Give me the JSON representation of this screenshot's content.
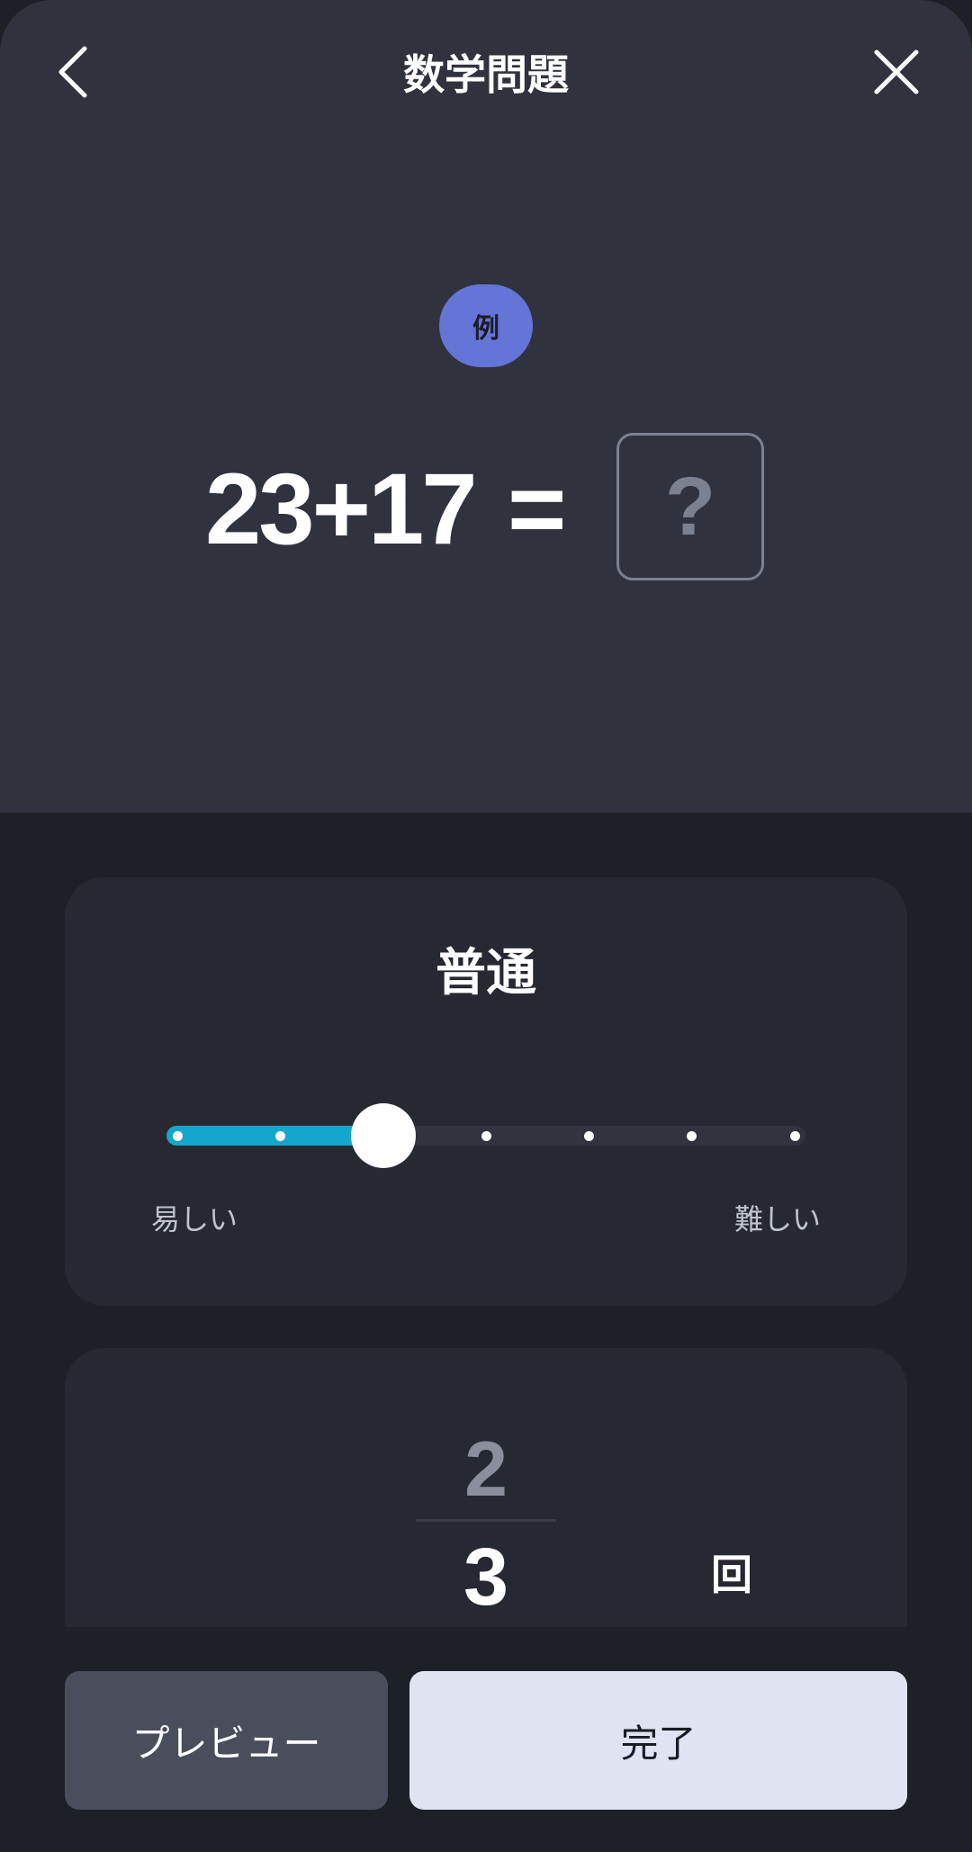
{
  "header": {
    "title": "数学問題",
    "back_icon": "chevron-left-icon",
    "close_icon": "close-icon"
  },
  "example": {
    "badge": "例",
    "badge_color": "#6474d7",
    "equation": "23+17",
    "equals": "=",
    "answer_placeholder": "?"
  },
  "difficulty": {
    "label": "普通",
    "min_label": "易しい",
    "max_label": "難しい",
    "levels": 7,
    "selected_index": 2,
    "accent_color": "#16a6cb"
  },
  "count_picker": {
    "previous": "2",
    "current": "3",
    "unit": "回"
  },
  "actions": {
    "preview_label": "プレビュー",
    "done_label": "完了"
  }
}
